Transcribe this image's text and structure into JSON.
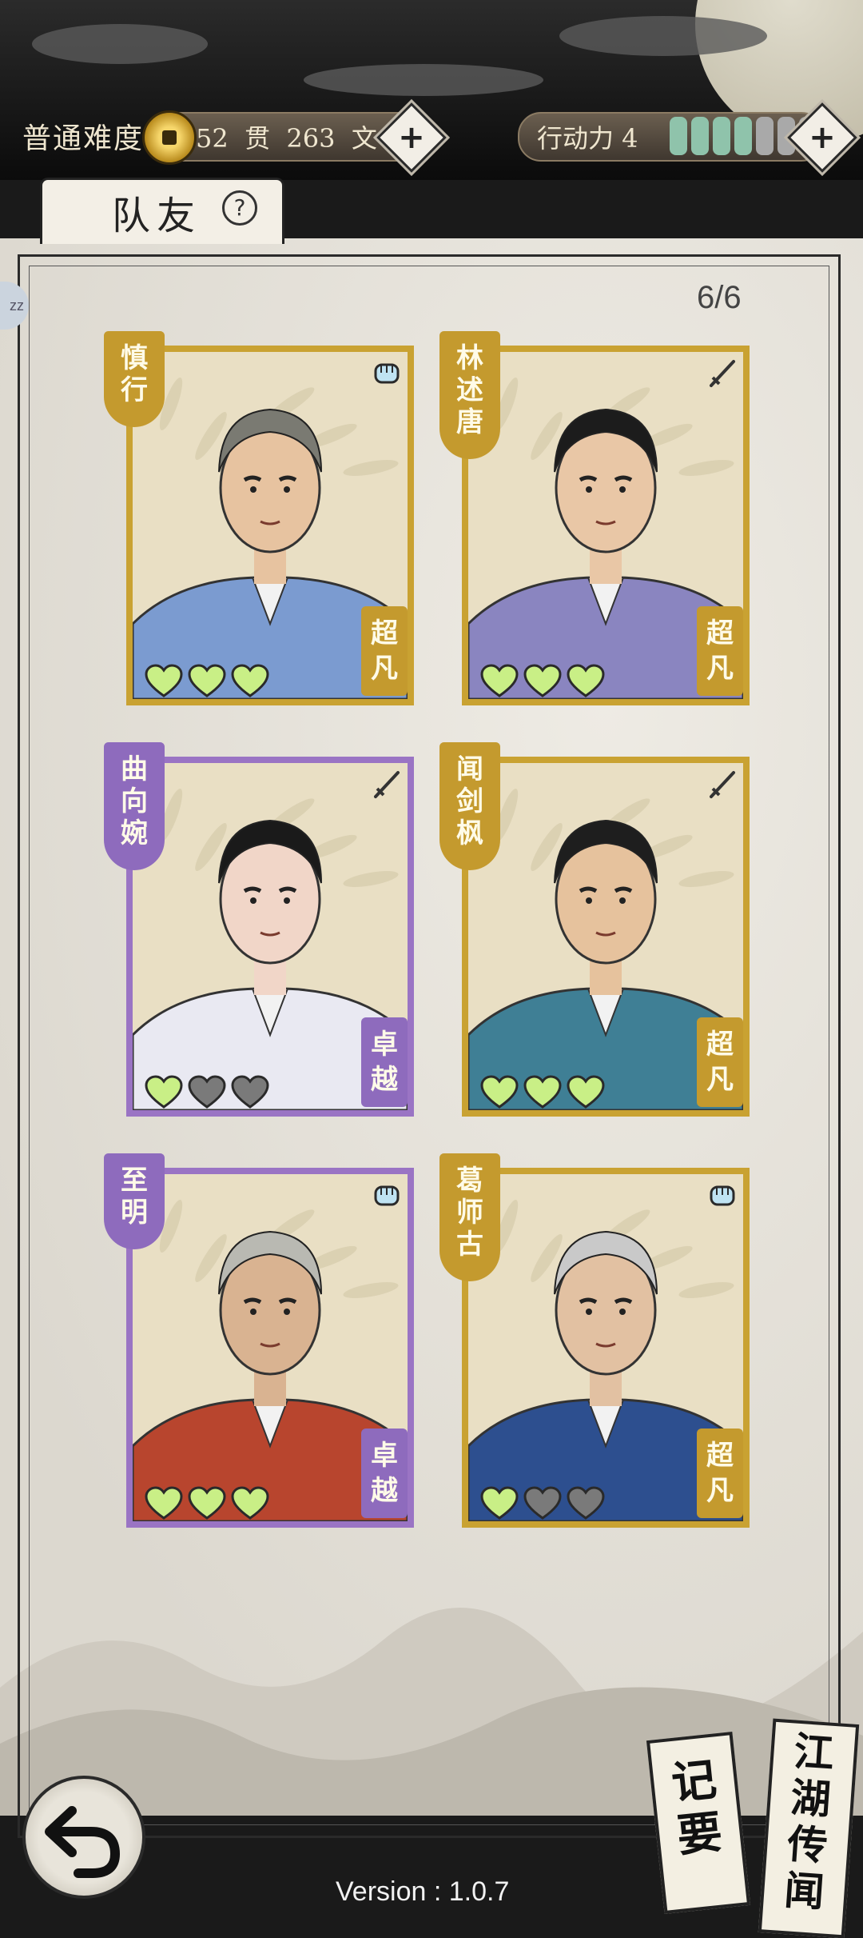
{
  "header": {
    "difficulty": "普通难度",
    "money_icon": "copper-coin-icon",
    "money_guan": "52",
    "money_guan_unit": "贯",
    "money_wen": "263",
    "money_wen_unit": "文",
    "action_label": "行动力 4",
    "action_level": 4,
    "action_max": 7,
    "add_icon": "plus-icon",
    "colors": {
      "pip_on": "#8fc3ab",
      "pip_off": "#a9a9a9"
    }
  },
  "panel": {
    "tab_title": "队友",
    "help_icon": "?",
    "count": "6/6",
    "side_badge": "zz"
  },
  "colors": {
    "gold": "#c9a232",
    "gold_banner": "#c49a2e",
    "purple": "#9a74c4",
    "purple_banner": "#8e6bbd",
    "heart_on": "#c9ef86",
    "heart_off": "#7a7a7a"
  },
  "companions": [
    {
      "name": "慎行",
      "rank": "超凡",
      "tier": "gold",
      "weapon_icon": "fist-icon",
      "hearts_on": 3,
      "hearts_total": 3
    },
    {
      "name": "林述唐",
      "rank": "超凡",
      "tier": "gold",
      "weapon_icon": "sword-icon",
      "hearts_on": 3,
      "hearts_total": 3
    },
    {
      "name": "曲向婉",
      "rank": "卓越",
      "tier": "purple",
      "weapon_icon": "sword-icon",
      "hearts_on": 1,
      "hearts_total": 3
    },
    {
      "name": "闻剑枫",
      "rank": "超凡",
      "tier": "gold",
      "weapon_icon": "sword-icon",
      "hearts_on": 3,
      "hearts_total": 3
    },
    {
      "name": "至明",
      "rank": "卓越",
      "tier": "purple",
      "weapon_icon": "fist-icon",
      "hearts_on": 3,
      "hearts_total": 3
    },
    {
      "name": "葛师古",
      "rank": "超凡",
      "tier": "gold",
      "weapon_icon": "fist-icon",
      "hearts_on": 1,
      "hearts_total": 3
    }
  ],
  "footer": {
    "back_icon": "back-arrow-icon",
    "notes_label": "记要",
    "rumors_label": "江湖传闻",
    "version": "Version : 1.0.7"
  }
}
